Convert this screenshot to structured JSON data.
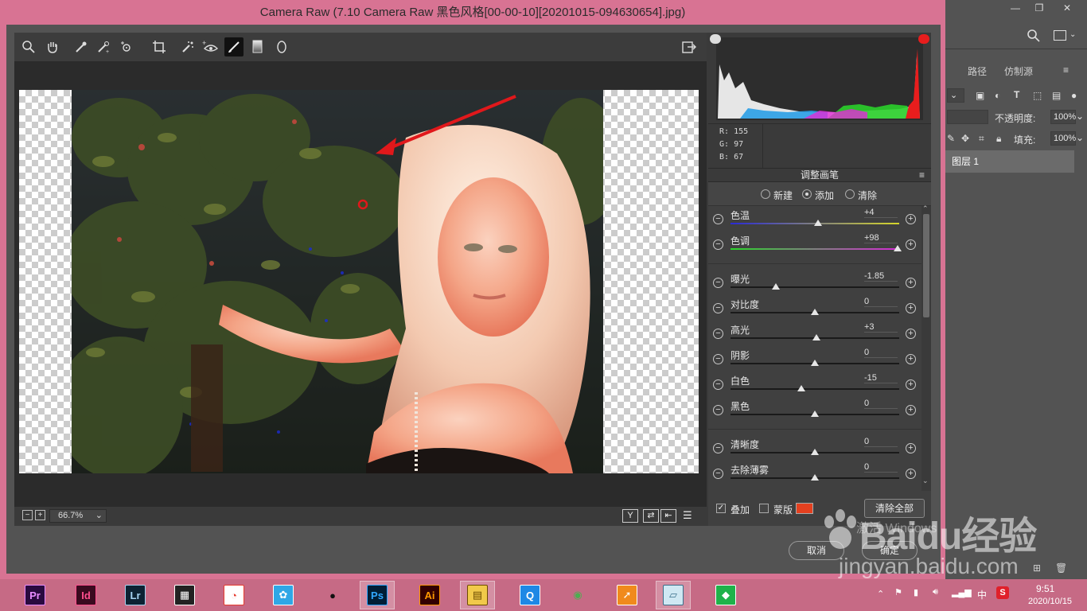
{
  "window": {
    "title": "Camera Raw (7.10 Camera Raw 黑色风格[00-00-10][20201015-094630654].jpg)"
  },
  "photoshop": {
    "tabs": [
      "路径",
      "仿制源"
    ],
    "opacity_label": "不透明度:",
    "opacity_value": "100%",
    "fill_label": "填充:",
    "fill_value": "100%",
    "layer_name": "图层 1"
  },
  "toolbar": {
    "tools": [
      "zoom-icon",
      "hand-icon",
      "white-balance-icon",
      "color-sampler-icon",
      "targeted-adjustment-icon",
      "crop-icon",
      "spot-removal-icon",
      "red-eye-icon",
      "adjustment-brush-icon",
      "graduated-filter-icon",
      "radial-filter-icon"
    ],
    "active_tool": "adjustment-brush-icon"
  },
  "canvas": {
    "zoom": "66.7%"
  },
  "histogram": {
    "r_label": "R:",
    "r_value": "155",
    "g_label": "G:",
    "g_value": "97",
    "b_label": "B:",
    "b_value": "67"
  },
  "panel": {
    "title": "调整画笔",
    "modes": [
      "新建",
      "添加",
      "清除"
    ],
    "selected_mode": "添加",
    "sliders": [
      {
        "label": "色温",
        "value": "+4",
        "level": 0.52,
        "track": "temp"
      },
      {
        "label": "色调",
        "value": "+98",
        "level": 0.99,
        "track": "tint"
      },
      {
        "label": "曝光",
        "value": "-1.85",
        "level": 0.27,
        "track": "plain"
      },
      {
        "label": "对比度",
        "value": "0",
        "level": 0.5,
        "track": "plain"
      },
      {
        "label": "高光",
        "value": "+3",
        "level": 0.51,
        "track": "plain"
      },
      {
        "label": "阴影",
        "value": "0",
        "level": 0.5,
        "track": "plain"
      },
      {
        "label": "白色",
        "value": "-15",
        "level": 0.42,
        "track": "plain"
      },
      {
        "label": "黑色",
        "value": "0",
        "level": 0.5,
        "track": "plain"
      },
      {
        "label": "清晰度",
        "value": "0",
        "level": 0.5,
        "track": "plain"
      },
      {
        "label": "去除薄雾",
        "value": "0",
        "level": 0.5,
        "track": "plain"
      }
    ],
    "overlay_label": "叠加",
    "overlay_checked": true,
    "mask_label": "蒙版",
    "mask_checked": false,
    "mask_color": "#e4401f",
    "clear_all_label": "清除全部"
  },
  "footer": {
    "cancel_label": "取消",
    "ok_label": "确定"
  },
  "watermark": {
    "activate_text": "激活 Windows",
    "brand_text": "Baidu经验",
    "url_text": "jingyan.baidu.com"
  },
  "taskbar": {
    "apps": [
      {
        "name": "premiere-icon",
        "label": "Pr",
        "bg": "#2a0a3f",
        "fg": "#e88cff",
        "active": false
      },
      {
        "name": "indesign-icon",
        "label": "Id",
        "bg": "#3a0a1f",
        "fg": "#ff4f8e",
        "active": false
      },
      {
        "name": "lightroom-icon",
        "label": "Lr",
        "bg": "#0c2233",
        "fg": "#a6d4f2",
        "active": false
      },
      {
        "name": "video-editor-icon",
        "label": "▦",
        "bg": "#222",
        "fg": "#fff",
        "active": false
      },
      {
        "name": "360-icon",
        "label": "◔",
        "bg": "#fff",
        "fg": "#e63b2e",
        "active": false
      },
      {
        "name": "chat-bird-icon",
        "label": "✿",
        "bg": "#2fa7e6",
        "fg": "#fff",
        "active": false
      },
      {
        "name": "qq-icon",
        "label": "●",
        "bg": "transparent",
        "fg": "#111",
        "active": false
      },
      {
        "name": "photoshop-icon",
        "label": "Ps",
        "bg": "#001e36",
        "fg": "#31a8ff",
        "active": true
      },
      {
        "name": "illustrator-icon",
        "label": "Ai",
        "bg": "#330000",
        "fg": "#ff9a00",
        "active": false
      },
      {
        "name": "file-explorer-icon",
        "label": "▤",
        "bg": "#f1c94a",
        "fg": "#6b4a00",
        "active": true
      },
      {
        "name": "browser-q-icon",
        "label": "Q",
        "bg": "#1e88e5",
        "fg": "#fff",
        "active": false
      },
      {
        "name": "chrome-icon",
        "label": "◉",
        "bg": "transparent",
        "fg": "#4caf50",
        "active": false
      },
      {
        "name": "sync-icon",
        "label": "➚",
        "bg": "#f08a1c",
        "fg": "#fff",
        "active": false
      },
      {
        "name": "notes-icon",
        "label": "▱",
        "bg": "#cfe8f3",
        "fg": "#3a6f8a",
        "active": true
      },
      {
        "name": "green-app-icon",
        "label": "◆",
        "bg": "#1fb24a",
        "fg": "#fff",
        "active": false
      }
    ],
    "ime": "中",
    "time": "9:51",
    "date": "2020/10/15"
  }
}
